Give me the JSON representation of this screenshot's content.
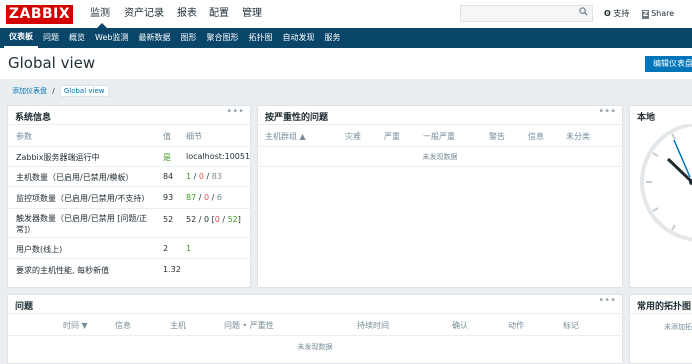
{
  "topbar": {
    "logo": "ZABBIX",
    "menu": [
      "监测",
      "资产记录",
      "报表",
      "配置",
      "管理"
    ],
    "search_icon": "search-icon",
    "support_label": "支持",
    "share_label": "Share"
  },
  "subnav": {
    "items": [
      "仪表板",
      "问题",
      "概览",
      "Web监测",
      "最新数据",
      "图形",
      "聚合图形",
      "拓扑图",
      "自动发现",
      "服务"
    ]
  },
  "page": {
    "title": "Global view",
    "edit_button": "编辑仪表盘",
    "breadcrumb_root": "添加仪表盘",
    "breadcrumb_sep": "/",
    "breadcrumb_current": "Global view"
  },
  "sysinfo": {
    "title": "系统信息",
    "dots": "•••",
    "headers": {
      "param": "参数",
      "value": "值",
      "detail": "细节"
    },
    "rows": [
      {
        "param": "Zabbix服务器端运行中",
        "value": "是",
        "detail": "localhost:10051"
      },
      {
        "param": "主机数量（已启用/已禁用/模板）",
        "value": "84",
        "d1": "1",
        "s1": " / ",
        "d2": "0",
        "s2": " / ",
        "d3": "83"
      },
      {
        "param": "监控项数量（已启用/已禁用/不支持）",
        "value": "93",
        "d1": "87",
        "s1": " / ",
        "d2": "0",
        "s2": " / ",
        "d3": "6"
      },
      {
        "param": "触发器数量（已启用/已禁用 [问题/正常]）",
        "value": "52",
        "d1": "52 / 0 [",
        "d2": "0",
        "s2": " / ",
        "d3": "52",
        "s3": "]"
      },
      {
        "param": "用户数(线上)",
        "value": "2",
        "detail": "1"
      },
      {
        "param": "要求的主机性能, 每秒新值",
        "value": "1.32",
        "detail": ""
      }
    ]
  },
  "severity": {
    "title": "按严重性的问题",
    "dots": "•••",
    "headers": [
      "主机群组 ▲",
      "灾难",
      "严重",
      "一般严重",
      "警告",
      "信息",
      "未分类"
    ],
    "empty": "未发现数据"
  },
  "clock": {
    "title": "本地"
  },
  "problems": {
    "title": "问题",
    "dots": "•••",
    "headers": [
      "时间 ▼",
      "信息",
      "主机",
      "问题 • 严重性",
      "持续时间",
      "确认",
      "动作",
      "标记"
    ],
    "empty": "未发现数据"
  },
  "topo": {
    "title": "常用的拓扑图",
    "empty": "未添加拓扑图"
  },
  "colors": {
    "brand_red": "#d40000",
    "nav_blue": "#0a466a",
    "accent_blue": "#0275b8",
    "ok_green": "#3a9d1e",
    "problem_red": "#d64e4e"
  }
}
